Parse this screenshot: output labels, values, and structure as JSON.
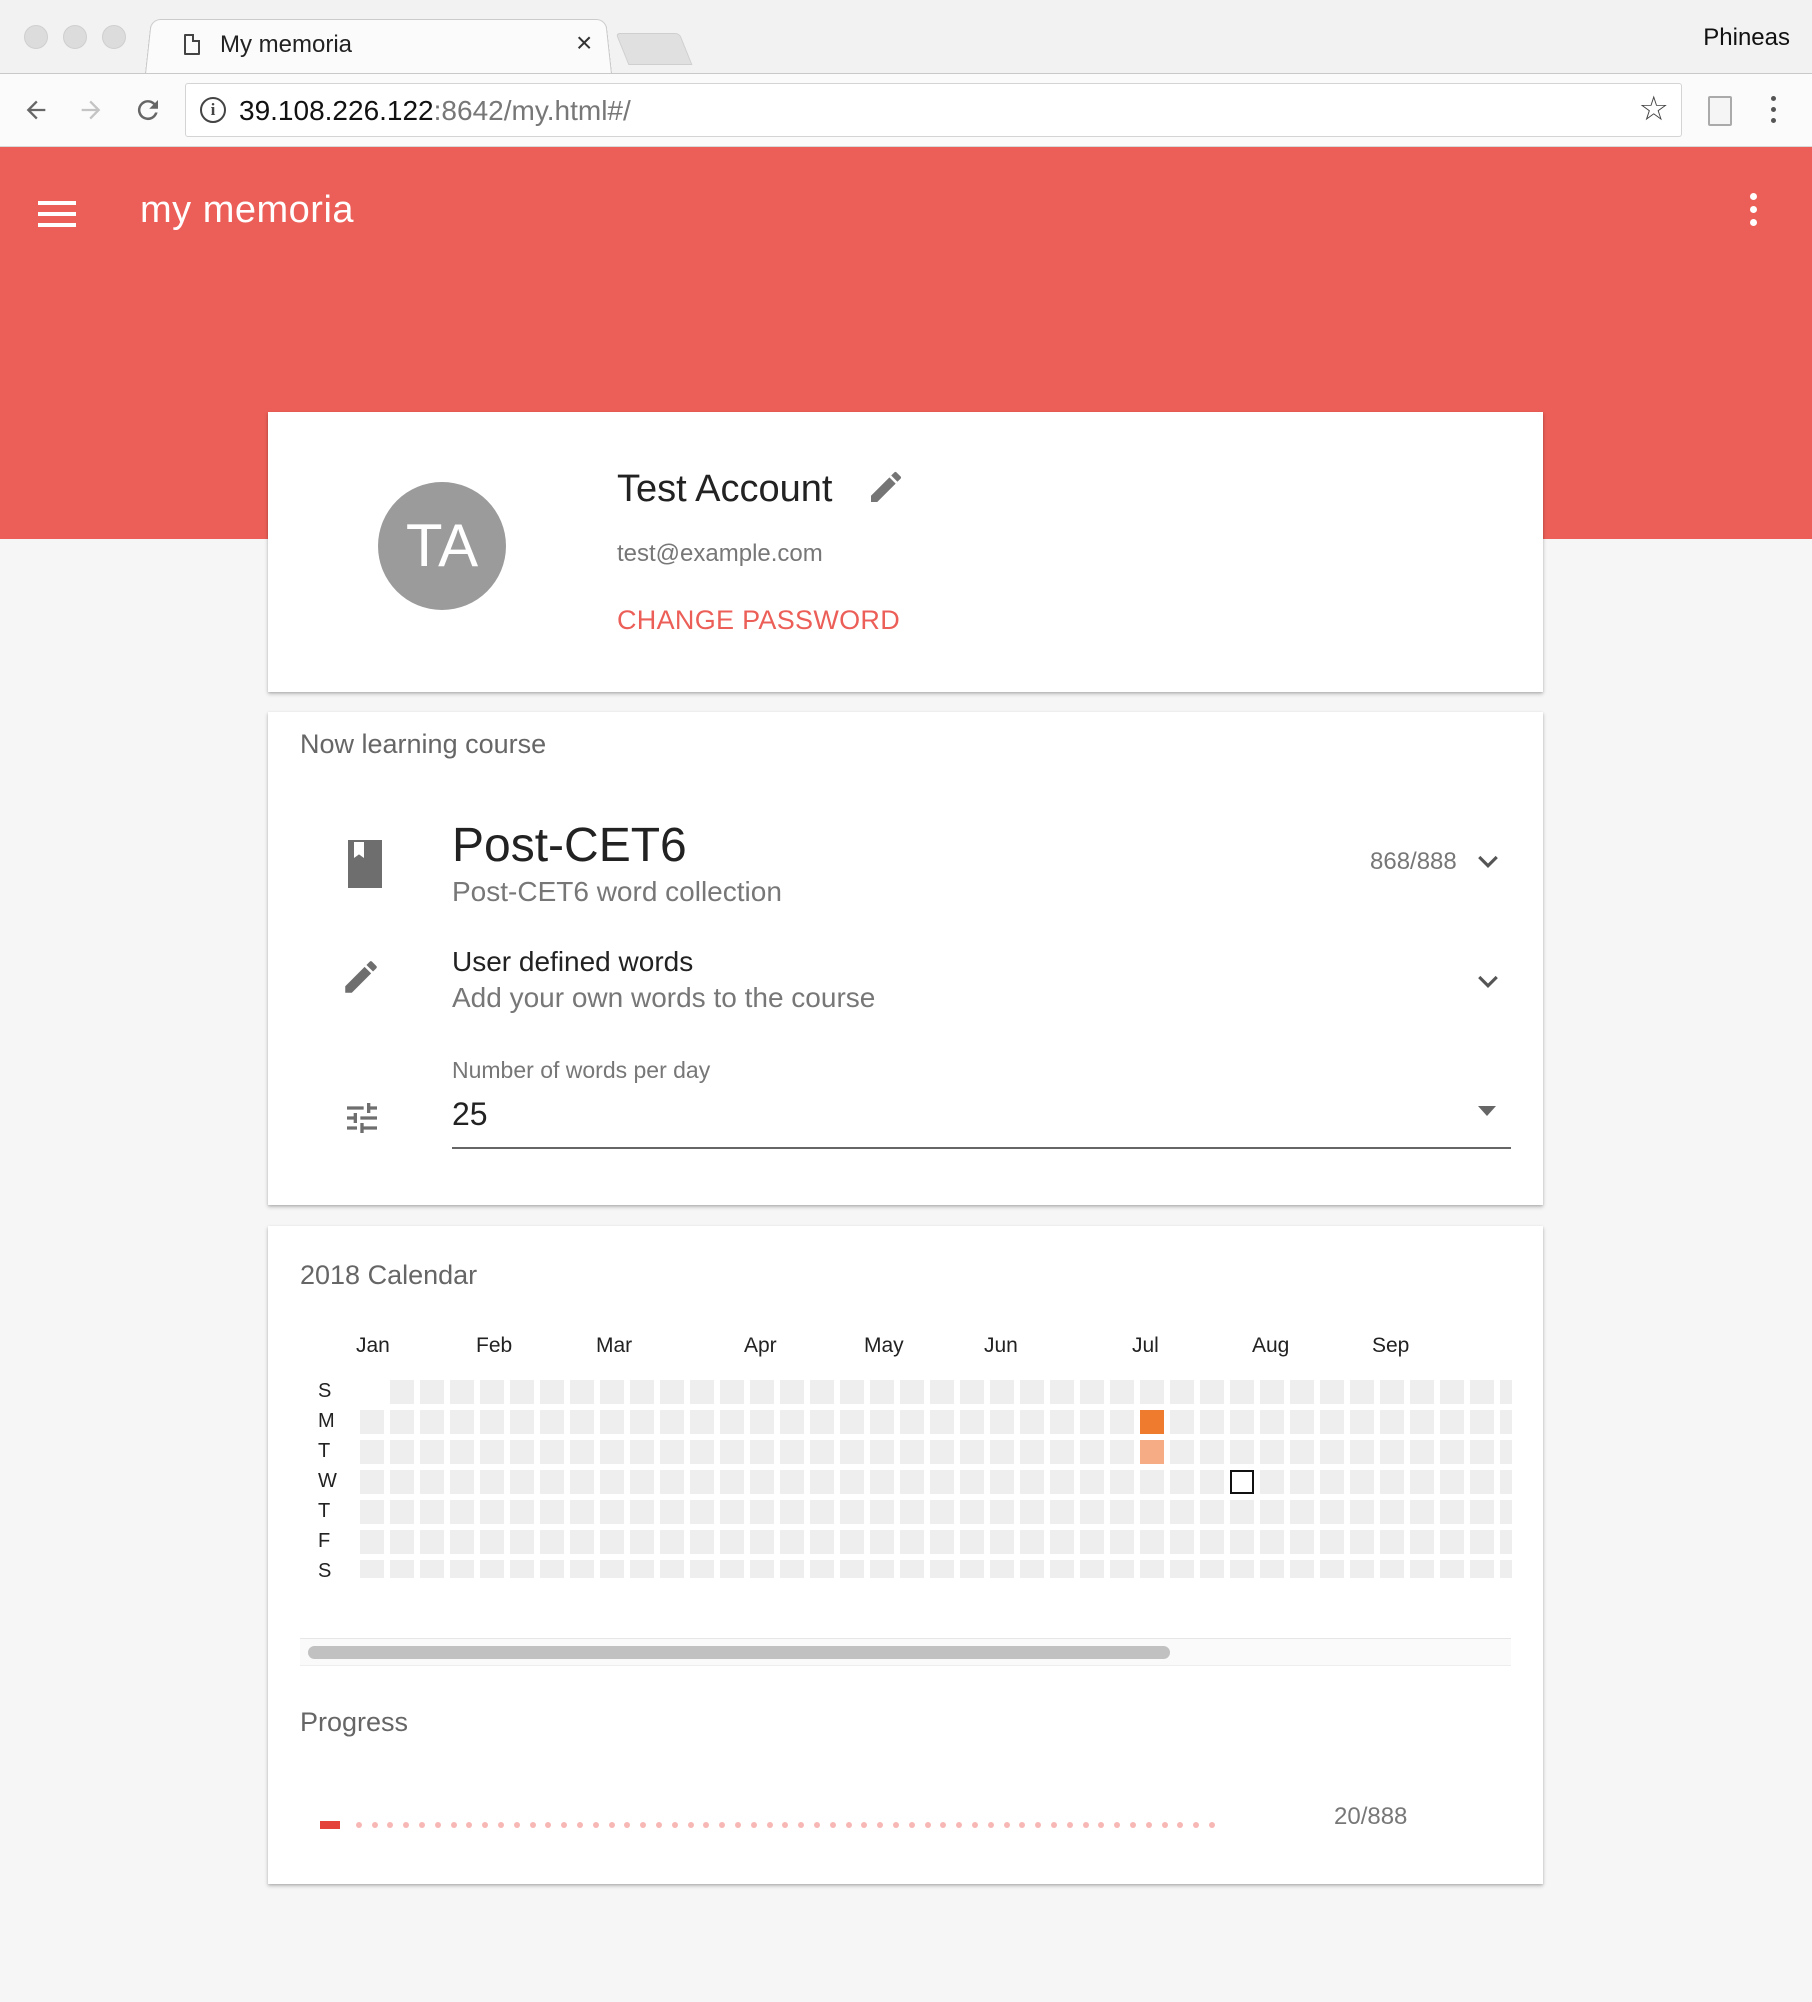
{
  "browser": {
    "tab_title": "My memoria",
    "profile_name": "Phineas",
    "url_host": "39.108.226.122",
    "url_rest": ":8642/my.html#/"
  },
  "app": {
    "title": "my memoria",
    "accent_color": "#ec5f58"
  },
  "profile": {
    "initials": "TA",
    "name": "Test Account",
    "email": "test@example.com",
    "change_password_label": "CHANGE PASSWORD"
  },
  "course": {
    "heading": "Now learning course",
    "title": "Post-CET6",
    "subtitle": "Post-CET6 word collection",
    "count": "868/888",
    "user_words_title": "User defined words",
    "user_words_subtitle": "Add your own words to the course",
    "words_per_day_label": "Number of words per day",
    "words_per_day_value": "25"
  },
  "calendar": {
    "heading": "2018 Calendar",
    "months": [
      "Jan",
      "Feb",
      "Mar",
      "Apr",
      "May",
      "Jun",
      "Jul",
      "Aug",
      "Sep"
    ],
    "days": [
      "S",
      "M",
      "T",
      "W",
      "T",
      "F",
      "S"
    ],
    "highlighted_cells": [
      {
        "week": 26,
        "day": 1,
        "level": "high",
        "color": "#ef7b2e"
      },
      {
        "week": 26,
        "day": 2,
        "level": "low",
        "color": "#f6ad85"
      }
    ],
    "today_cell": {
      "week": 29,
      "day": 3
    }
  },
  "progress": {
    "heading": "Progress",
    "count": "20/888",
    "learned": 20,
    "total": 888
  }
}
